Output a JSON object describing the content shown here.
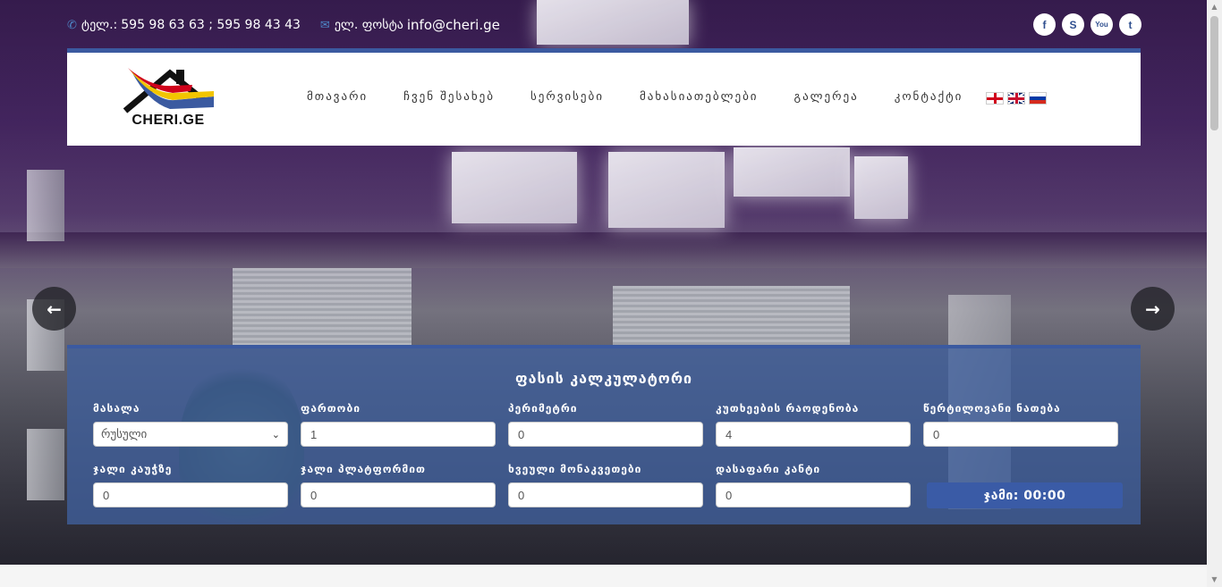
{
  "topbar": {
    "phone_icon": "phone-icon",
    "phone_label": "ტელ.:",
    "phone": "595 98 63 63 ; 595 98 43 43",
    "email_icon": "envelope-icon",
    "email_label": "ელ. ფოსტა",
    "email": "info@cheri.ge"
  },
  "social": [
    {
      "name": "facebook-icon",
      "glyph": "f"
    },
    {
      "name": "skype-icon",
      "glyph": "S"
    },
    {
      "name": "youtube-icon",
      "glyph": "You"
    },
    {
      "name": "twitter-icon",
      "glyph": "t"
    }
  ],
  "logo": {
    "text": "CHERI.GE"
  },
  "menu": [
    "მთავარი",
    "ჩვენ შესახებ",
    "სერვისები",
    "მახასიათებლები",
    "გალერეა",
    "კონტაქტი"
  ],
  "flags": [
    "georgian-flag",
    "english-flag",
    "russian-flag"
  ],
  "slider": {
    "prev": "←",
    "next": "→"
  },
  "calculator": {
    "title": "ფასის კალკულატორი",
    "fields": [
      {
        "label": "მასალა",
        "value": "რუსული",
        "type": "select"
      },
      {
        "label": "ფართობი",
        "value": "1"
      },
      {
        "label": "პერიმეტრი",
        "value": "0"
      },
      {
        "label": "კუთხეების რაოდენობა",
        "value": "4"
      },
      {
        "label": "წერტილოვანი ნათება",
        "value": "0"
      },
      {
        "label": "ჯალი კაუჭზე",
        "value": "0"
      },
      {
        "label": "ჯალი პლატფორმით",
        "value": "0"
      },
      {
        "label": "ხვეული მონაკვეთები",
        "value": "0"
      },
      {
        "label": "დასაფარი კანტი",
        "value": "0"
      }
    ],
    "total": "ჯამი: 00:00"
  },
  "colors": {
    "accent": "#3b5aa0",
    "panel": "#40609e"
  }
}
